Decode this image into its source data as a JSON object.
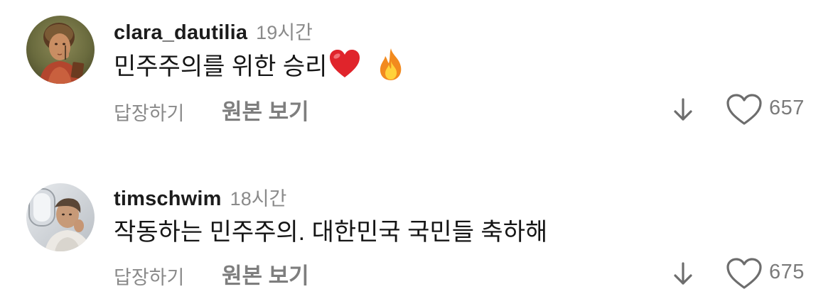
{
  "comments": [
    {
      "username": "clara_dautilia",
      "time": "19시간",
      "text": "민주주의를 위한 승리",
      "emojis": [
        "heart-emoji",
        "fire-emoji"
      ],
      "reply_label": "답장하기",
      "see_original_label": "원본 보기",
      "likes": "657",
      "avatar": "fresco-portrait-avatar"
    },
    {
      "username": "timschwim",
      "time": "18시간",
      "text": "작동하는 민주주의. 대한민국 국민들 축하해",
      "emojis": [],
      "reply_label": "답장하기",
      "see_original_label": "원본 보기",
      "likes": "675",
      "avatar": "airplane-window-avatar"
    }
  ],
  "colors": {
    "text": "#151515",
    "muted": "#8a8a8a",
    "heart_red": "#e0242b",
    "fire_orange": "#f28a1e"
  }
}
